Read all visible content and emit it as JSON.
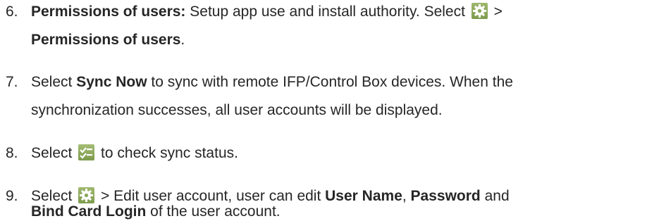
{
  "steps": [
    {
      "number": "6.",
      "bold_lead": "Permissions of users:",
      "text_a": " Setup app use and install authority. Select ",
      "icon": "gear-icon",
      "text_b": " >",
      "bold_line2": "Permissions of users",
      "end_line2": "."
    },
    {
      "number": "7.",
      "text_a": "Select ",
      "bold_a": "Sync Now",
      "text_b": " to sync with remote IFP/Control Box devices. When the",
      "line2": "synchronization successes, all user accounts will be displayed."
    },
    {
      "number": "8.",
      "text_a": "Select ",
      "icon": "checklist-icon",
      "text_b": " to check sync status."
    },
    {
      "number": "9.",
      "text_a": "Select ",
      "icon": "gear-icon",
      "text_b": " > Edit user account, user can edit ",
      "bold_a": "User Name",
      "text_c": ", ",
      "bold_b": "Password",
      "text_d": " and",
      "bold_line2": "Bind Card Login",
      "end_line2": " of the user account."
    }
  ],
  "colors": {
    "text": "#262626",
    "icon_green": "#8aa85b"
  }
}
